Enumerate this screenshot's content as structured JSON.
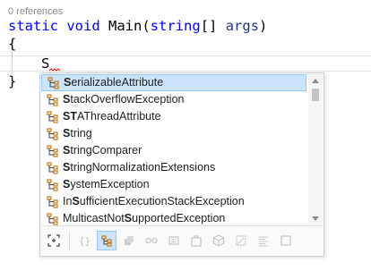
{
  "editor": {
    "codelens": "0 references",
    "line1": {
      "kw1": "static",
      "kw2": "void",
      "method": "Main",
      "paren_open": "(",
      "type": "string",
      "brackets": "[]",
      "param": "args",
      "paren_close": ")"
    },
    "brace_open": "{",
    "typed": "S",
    "brace_close": "}"
  },
  "completion": {
    "items": [
      {
        "match": "S",
        "rest": "erializableAttribute",
        "icon": "class-icon",
        "selected": true
      },
      {
        "match": "S",
        "rest": "tackOverflowException",
        "icon": "class-icon"
      },
      {
        "match": "ST",
        "rest": "AThreadAttribute",
        "icon": "class-icon"
      },
      {
        "match": "S",
        "rest": "tring",
        "icon": "class-icon"
      },
      {
        "match": "S",
        "rest": "tringComparer",
        "icon": "class-icon"
      },
      {
        "match": "S",
        "rest": "tringNormalizationExtensions",
        "icon": "class-icon"
      },
      {
        "match": "S",
        "rest": "ystemException",
        "icon": "class-icon"
      },
      {
        "prefix": "In",
        "match": "S",
        "rest": "ufficientExecutionStackException",
        "icon": "class-icon"
      },
      {
        "prefix": "MulticastNot",
        "match": "S",
        "rest": "upportedException",
        "icon": "class-icon"
      }
    ],
    "filters": [
      "expand-scope-icon",
      "namespace-icon",
      "class-icon",
      "struct-icon",
      "interface-icon",
      "enum-icon",
      "delegate-icon",
      "module-icon",
      "snippet-icon",
      "keyword-icon",
      "generic-icon"
    ],
    "colors": {
      "selection_bg": "#cce4fb",
      "selection_border": "#99c9ef",
      "class_icon": "#c27d1a",
      "keyword": "#0000ff"
    }
  }
}
